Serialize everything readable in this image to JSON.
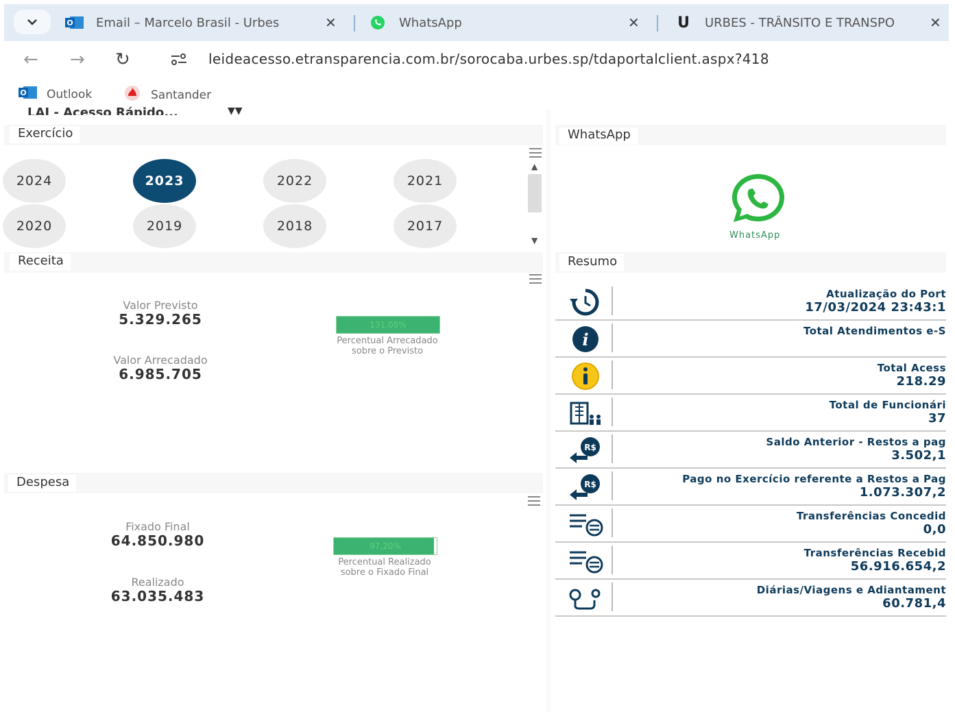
{
  "browser": {
    "tabs": [
      {
        "label": "Email – Marcelo Brasil - Urbes",
        "icon": "outlook-icon"
      },
      {
        "label": "WhatsApp",
        "icon": "whatsapp-icon"
      },
      {
        "label": "URBES - TRÂNSITO E TRANSPO",
        "icon": "urbes-icon"
      }
    ],
    "url": "leideacesso.etransparencia.com.br/sorocaba.urbes.sp/tdaportalclient.aspx?418",
    "bookmarks": [
      {
        "label": "Outlook"
      },
      {
        "label": "Santander"
      }
    ],
    "accent": "#e3ecf5"
  },
  "page": {
    "cutoff_text": "LAI - Acesso Rápido...",
    "exercicio": {
      "label": "Exercício",
      "years": [
        "2024",
        "2023",
        "2022",
        "2021",
        "2020",
        "2019",
        "2018",
        "2017"
      ],
      "selected": "2023",
      "selected_color": "#0e4b73"
    },
    "receita": {
      "label": "Receita",
      "previsto_label": "Valor Previsto",
      "previsto_value": "5.329.265",
      "arrecadado_label": "Valor Arrecadado",
      "arrecadado_value": "6.985.705",
      "percent": "131,08%",
      "percent_fill": 1.0,
      "percent_caption": "Percentual Arrecadado sobre o Previsto"
    },
    "despesa": {
      "label": "Despesa",
      "fixado_label": "Fixado Final",
      "fixado_value": "64.850.980",
      "realizado_label": "Realizado",
      "realizado_value": "63.035.483",
      "percent": "97,20%",
      "percent_fill": 0.972,
      "percent_caption": "Percentual Realizado sobre o Fixado Final"
    },
    "whatsapp": {
      "label": "WhatsApp",
      "logo_text": "WhatsApp",
      "color": "#2db742"
    },
    "resumo": {
      "label": "Resumo",
      "items": [
        {
          "icon": "history-clock-icon",
          "title": "Atualização do Port",
          "value": "17/03/2024 23:43:1"
        },
        {
          "icon": "info-dark-icon",
          "title": "Total Atendimentos e-S",
          "value": ""
        },
        {
          "icon": "info-yellow-icon",
          "title": "Total Acess",
          "value": "218.29"
        },
        {
          "icon": "building-people-icon",
          "title": "Total de Funcionári",
          "value": "37"
        },
        {
          "icon": "money-return-icon",
          "title": "Saldo Anterior - Restos a pag",
          "value": "3.502,1"
        },
        {
          "icon": "money-return-icon",
          "title": "Pago no Exercício referente a Restos a Pag",
          "value": "1.073.307,2"
        },
        {
          "icon": "transfer-list-icon",
          "title": "Transferências Concedid",
          "value": "0,0"
        },
        {
          "icon": "transfer-list-icon",
          "title": "Transferências Recebid",
          "value": "56.916.654,2"
        },
        {
          "icon": "route-icon",
          "title": "Diárias/Viagens e Adiantament",
          "value": "60.781,4"
        }
      ]
    }
  }
}
